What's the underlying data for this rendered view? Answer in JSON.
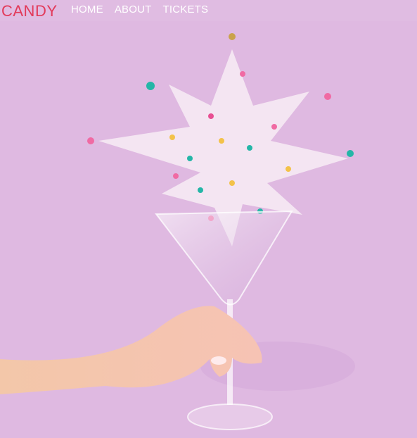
{
  "brand": {
    "name": "CANDY",
    "color": "#e23a5a"
  },
  "nav": {
    "items": [
      {
        "label": "HOME"
      },
      {
        "label": "ABOUT"
      },
      {
        "label": "TICKETS"
      }
    ]
  },
  "colors": {
    "background": "#dfb9e1",
    "nav_text": "#ffffff"
  },
  "hero": {
    "icon": "sprinkles-martini-glass-image"
  }
}
